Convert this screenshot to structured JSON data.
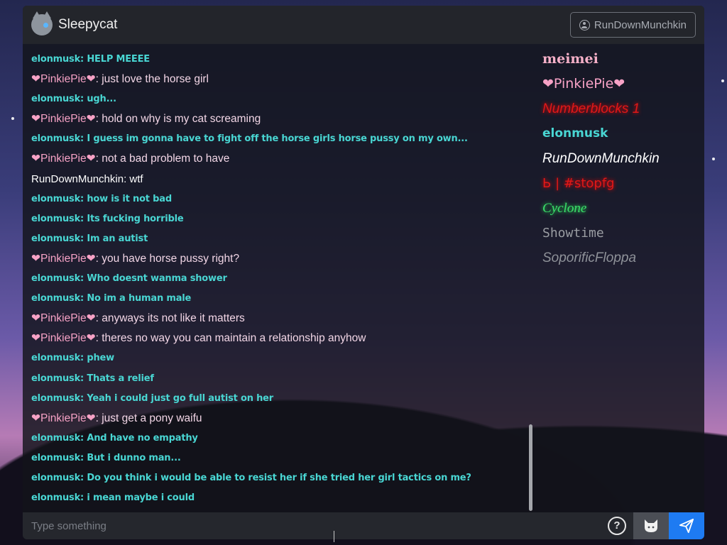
{
  "app": {
    "title": "Sleepycat"
  },
  "header": {
    "username": "RunDownMunchkin"
  },
  "messages": [
    {
      "user": "elonmusk",
      "style": "elon",
      "text": "HELP MEEEE"
    },
    {
      "user": "❤PinkiePie❤",
      "style": "pinkie",
      "text": "just love the horse girl"
    },
    {
      "user": "elonmusk",
      "style": "elon",
      "text": "ugh..."
    },
    {
      "user": "❤PinkiePie❤",
      "style": "pinkie",
      "text": "hold on why is my cat screaming"
    },
    {
      "user": "elonmusk",
      "style": "elon",
      "text": "I guess im gonna have to fight off the horse girls horse pussy on my own..."
    },
    {
      "user": "❤PinkiePie❤",
      "style": "pinkie",
      "text": "not a bad problem to have"
    },
    {
      "user": "RunDownMunchkin",
      "style": "rdm",
      "text": "wtf"
    },
    {
      "user": "elonmusk",
      "style": "elon",
      "text": "how is it not bad"
    },
    {
      "user": "elonmusk",
      "style": "elon",
      "text": "Its fucking horrible"
    },
    {
      "user": "elonmusk",
      "style": "elon",
      "text": "Im an autist"
    },
    {
      "user": "❤PinkiePie❤",
      "style": "pinkie",
      "text": "you have horse pussy right?"
    },
    {
      "user": "elonmusk",
      "style": "elon",
      "text": "Who doesnt wanma shower"
    },
    {
      "user": "elonmusk",
      "style": "elon",
      "text": "No im a human male"
    },
    {
      "user": "❤PinkiePie❤",
      "style": "pinkie",
      "text": "anyways its not like it matters"
    },
    {
      "user": "❤PinkiePie❤",
      "style": "pinkie",
      "text": "theres no way you can maintain a relationship anyhow"
    },
    {
      "user": "elonmusk",
      "style": "elon",
      "text": "phew"
    },
    {
      "user": "elonmusk",
      "style": "elon",
      "text": "Thats a relief"
    },
    {
      "user": "elonmusk",
      "style": "elon",
      "text": "Yeah i could just go full autist on her"
    },
    {
      "user": "❤PinkiePie❤",
      "style": "pinkie",
      "text": "just get a pony waifu"
    },
    {
      "user": "elonmusk",
      "style": "elon",
      "text": "And have no empathy"
    },
    {
      "user": "elonmusk",
      "style": "elon",
      "text": "But i dunno man..."
    },
    {
      "user": "elonmusk",
      "style": "elon",
      "text": "Do you think i would be able to resist her if she tried her girl tactics on me?"
    },
    {
      "user": "elonmusk",
      "style": "elon",
      "text": "i mean maybe i could"
    }
  ],
  "users": [
    {
      "name": "meimei",
      "style": "meimei"
    },
    {
      "name": "❤PinkiePie❤",
      "style": "pinkie"
    },
    {
      "name": "Numberblocks 1",
      "style": "numberblocks"
    },
    {
      "name": "elonmusk",
      "style": "elon"
    },
    {
      "name": "RunDownMunchkin",
      "style": "rdm"
    },
    {
      "name": "Ь | #stopfg",
      "style": "stopfg"
    },
    {
      "name": "Cyclone",
      "style": "cyclone"
    },
    {
      "name": "Showtime",
      "style": "showtime"
    },
    {
      "name": "SoporificFloppa",
      "style": "soporific"
    }
  ],
  "input": {
    "placeholder": "Type something",
    "value": ""
  },
  "buttons": {
    "help_label": "?"
  },
  "colors": {
    "accent": "#1e7bf2",
    "elon": "#49d6d3",
    "pinkie": "#f7a2c6"
  }
}
